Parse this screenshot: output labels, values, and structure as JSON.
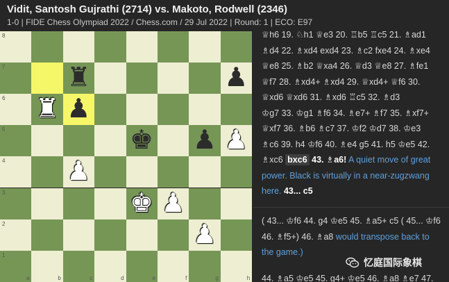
{
  "header": {
    "title": "Vidit, Santosh Gujrathi (2714) vs. Makoto, Rodwell (2346)",
    "subtitle": "1-0 | FIDE Chess Olympiad 2022 / Chess.com / 29 Jul 2022 | Round: 1 | ECO: E97"
  },
  "board": {
    "rank_labels": [
      "8",
      "7",
      "6",
      "5",
      "4",
      "3",
      "2",
      "1"
    ],
    "file_labels": [
      "a",
      "b",
      "c",
      "d",
      "e",
      "f",
      "g",
      "h"
    ],
    "highlighted_squares": [
      "b7",
      "c6"
    ],
    "pieces": [
      {
        "square": "c7",
        "color": "black",
        "type": "rook",
        "glyph": "♜"
      },
      {
        "square": "h7",
        "color": "black",
        "type": "pawn",
        "glyph": "♟"
      },
      {
        "square": "b6",
        "color": "white",
        "type": "rook",
        "glyph": "♜"
      },
      {
        "square": "c6",
        "color": "black",
        "type": "pawn",
        "glyph": "♟"
      },
      {
        "square": "e5",
        "color": "black",
        "type": "king",
        "glyph": "♚"
      },
      {
        "square": "g5",
        "color": "black",
        "type": "pawn",
        "glyph": "♟"
      },
      {
        "square": "h5",
        "color": "white",
        "type": "pawn",
        "glyph": "♟"
      },
      {
        "square": "c4",
        "color": "white",
        "type": "pawn",
        "glyph": "♟"
      },
      {
        "square": "e3",
        "color": "white",
        "type": "king",
        "glyph": "♚"
      },
      {
        "square": "f3",
        "color": "white",
        "type": "pawn",
        "glyph": "♟"
      },
      {
        "square": "g2",
        "color": "white",
        "type": "pawn",
        "glyph": "♟"
      }
    ]
  },
  "notation": {
    "lines": [
      "♕h6 19. ♘h1 ♕e3 20. ♖b5 ♖c5 21. ♗ad1",
      "♗d4 22. ♗xd4 exd4 23. ♗c2 fxe4 24. ♗xe4",
      "♕e8 25. ♗b2 ♕xa4 26. ♕d3 ♕e8 27. ♗fe1",
      "♕f7 28. ♗xd4+ ♗xd4 29. ♕xd4+ ♕f6 30.",
      "♕xd6 ♕xd6 31. ♗xd6 ♖c5 32. ♗d3",
      "♔g7 33. ♔g1 ♗f6 34. ♗e7+ ♗f7 35. ♗xf7+",
      "♕xf7 36. ♗b6 ♗c7 37. ♔f2 ♔d7 38. ♔e3",
      "♗c6 39. h4 ♔f6 40. ♗e4 g5 41. h5 ♔e5 42."
    ],
    "current_line_prefix": "♗xc6",
    "current_move": "bxc6",
    "after_current": "43. ♗a6!",
    "comment": "A quiet move of great power. Black is virtually in a near-zugzwang here.",
    "comment_tail_move": "43... c5",
    "variation": "( 43... ♔f6 44. g4 ♔e5 45. ♗a5+ c5 ( 45... ♔f6 46. ♗f5+) 46. ♗a8",
    "variation_comment": "would transpose back to the game.)",
    "bottom_line": "44. ♗a5 ♔e5 45. g4+ ♔e5 46. ♗a8 ♗e7 47."
  },
  "watermark": {
    "icon": "wechat-icon",
    "text": "忆庭国际象棋"
  }
}
